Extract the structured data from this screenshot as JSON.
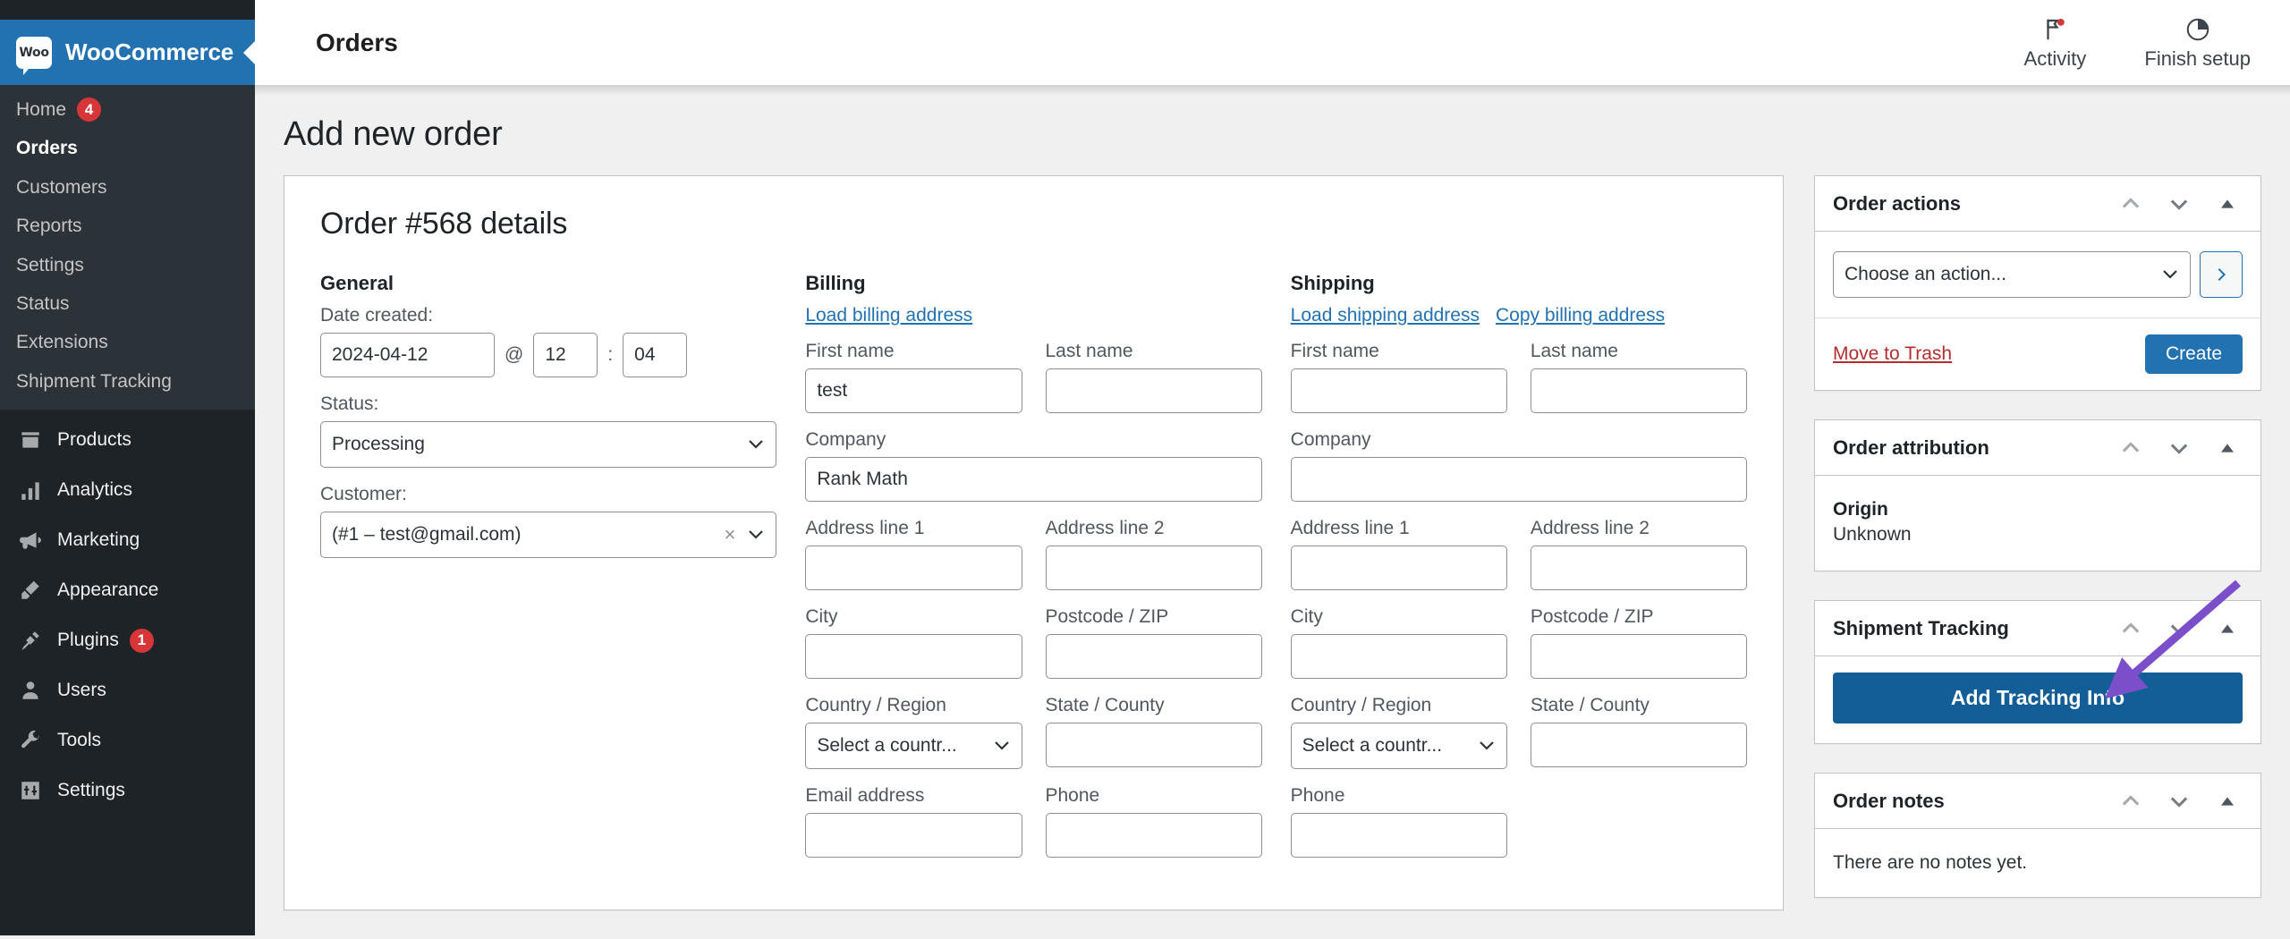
{
  "sidebar": {
    "brand": {
      "logo_text": "Woo",
      "name": "WooCommerce"
    },
    "submenu": [
      {
        "label": "Home",
        "badge": "4",
        "current": false
      },
      {
        "label": "Orders",
        "badge": "",
        "current": true
      },
      {
        "label": "Customers",
        "badge": "",
        "current": false
      },
      {
        "label": "Reports",
        "badge": "",
        "current": false
      },
      {
        "label": "Settings",
        "badge": "",
        "current": false
      },
      {
        "label": "Status",
        "badge": "",
        "current": false
      },
      {
        "label": "Extensions",
        "badge": "",
        "current": false
      },
      {
        "label": "Shipment Tracking",
        "badge": "",
        "current": false
      }
    ],
    "menu": [
      {
        "label": "Products",
        "icon": "products-icon",
        "badge": ""
      },
      {
        "label": "Analytics",
        "icon": "analytics-icon",
        "badge": ""
      },
      {
        "label": "Marketing",
        "icon": "megaphone-icon",
        "badge": ""
      },
      {
        "label": "Appearance",
        "icon": "paintbrush-icon",
        "badge": ""
      },
      {
        "label": "Plugins",
        "icon": "plug-icon",
        "badge": "1"
      },
      {
        "label": "Users",
        "icon": "user-icon",
        "badge": ""
      },
      {
        "label": "Tools",
        "icon": "wrench-icon",
        "badge": ""
      },
      {
        "label": "Settings",
        "icon": "sliders-icon",
        "badge": ""
      }
    ]
  },
  "header": {
    "breadcrumb": "Orders",
    "activity": {
      "label": "Activity",
      "icon": "flag-icon"
    },
    "finish_setup": {
      "label": "Finish setup",
      "icon": "pie-progress-icon"
    }
  },
  "page": {
    "title": "Add new order"
  },
  "order": {
    "details_title": "Order #568 details",
    "general": {
      "heading": "General",
      "date_label": "Date created:",
      "date_value": "2024-04-12",
      "at_symbol": "@",
      "hour_value": "12",
      "colon": ":",
      "minute_value": "04",
      "status_label": "Status:",
      "status_value": "Processing",
      "customer_label": "Customer:",
      "customer_value": "(#1 – test@gmail.com)",
      "clear_glyph": "×"
    },
    "billing": {
      "heading": "Billing",
      "links": [
        "Load billing address"
      ],
      "first_name_label": "First name",
      "first_name_value": "test",
      "last_name_label": "Last name",
      "last_name_value": "",
      "company_label": "Company",
      "company_value": "Rank Math",
      "address1_label": "Address line 1",
      "address1_value": "",
      "address2_label": "Address line 2",
      "address2_value": "",
      "city_label": "City",
      "city_value": "",
      "postcode_label": "Postcode / ZIP",
      "postcode_value": "",
      "country_label": "Country / Region",
      "country_value": "Select a countr...",
      "state_label": "State / County",
      "state_value": "",
      "email_label": "Email address",
      "email_value": "",
      "phone_label": "Phone",
      "phone_value": ""
    },
    "shipping": {
      "heading": "Shipping",
      "links": [
        "Load shipping address",
        "Copy billing address"
      ],
      "first_name_label": "First name",
      "first_name_value": "",
      "last_name_label": "Last name",
      "last_name_value": "",
      "company_label": "Company",
      "company_value": "",
      "address1_label": "Address line 1",
      "address1_value": "",
      "address2_label": "Address line 2",
      "address2_value": "",
      "city_label": "City",
      "city_value": "",
      "postcode_label": "Postcode / ZIP",
      "postcode_value": "",
      "country_label": "Country / Region",
      "country_value": "Select a countr...",
      "state_label": "State / County",
      "state_value": "",
      "phone_label": "Phone",
      "phone_value": ""
    }
  },
  "side": {
    "order_actions": {
      "title": "Order actions",
      "action_select_value": "Choose an action...",
      "apply_glyph": "›",
      "trash_label": "Move to Trash",
      "create_label": "Create"
    },
    "order_attribution": {
      "title": "Order attribution",
      "origin_label": "Origin",
      "origin_value": "Unknown"
    },
    "shipment_tracking": {
      "title": "Shipment Tracking",
      "add_button": "Add Tracking Info"
    },
    "order_notes": {
      "title": "Order notes",
      "empty_text": "There are no notes yet."
    }
  },
  "annotation": {
    "arrow_color": "#7b4fc9"
  },
  "colors": {
    "sidebar_bg": "#1d2327",
    "submenu_bg": "#2c3338",
    "brand_blue": "#2271b1",
    "badge_red": "#d63638",
    "link_blue": "#2271b1",
    "trash_red": "#b32d2e",
    "track_button": "#135e96"
  }
}
